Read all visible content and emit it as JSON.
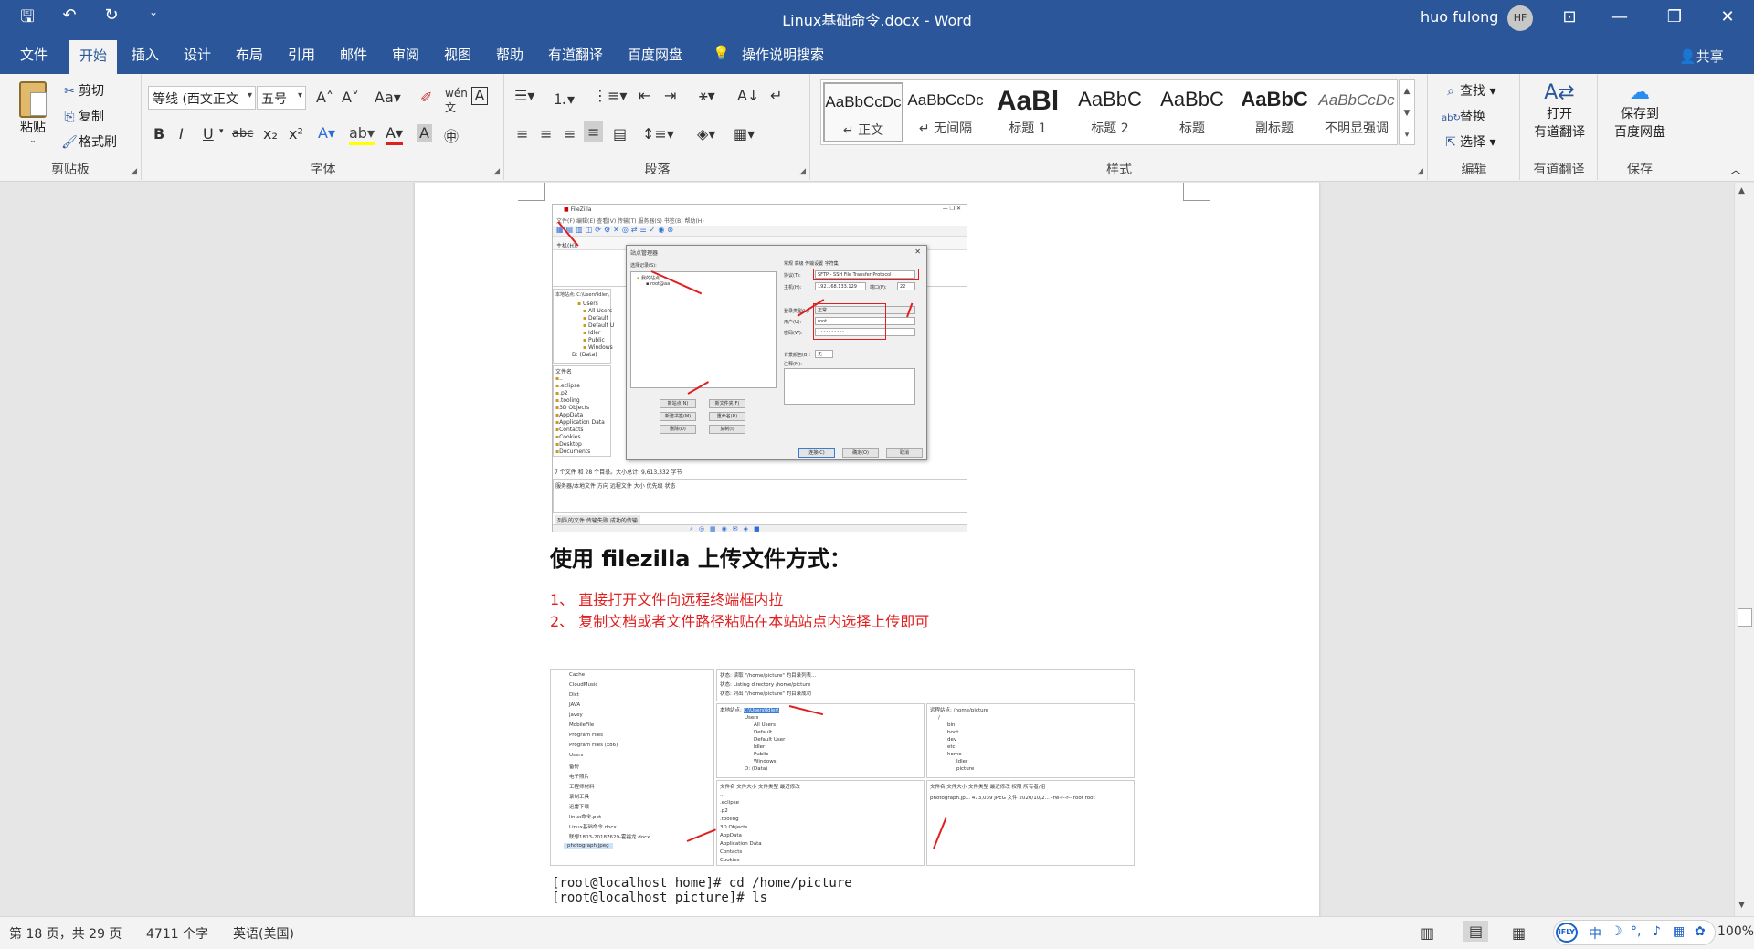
{
  "titlebar": {
    "doc_title": "Linux基础命令.docx  -  Word",
    "user": "huo fulong",
    "avatar": "HF",
    "qat_icons": [
      "save-icon",
      "undo-icon",
      "redo-icon",
      "customize-icon"
    ],
    "window_icons": [
      "ribbon-display-icon",
      "minimize-icon",
      "restore-icon",
      "close-icon"
    ]
  },
  "tabs": [
    "文件",
    "开始",
    "插入",
    "设计",
    "布局",
    "引用",
    "邮件",
    "审阅",
    "视图",
    "帮助",
    "有道翻译",
    "百度网盘"
  ],
  "active_tab": "开始",
  "tell_me": "操作说明搜索",
  "share": "共享",
  "ribbon": {
    "clipboard": {
      "paste": "粘贴",
      "cut": "剪切",
      "copy": "复制",
      "format_painter": "格式刷",
      "label": "剪贴板"
    },
    "font": {
      "name": "等线 (西文正文",
      "size": "五号",
      "label": "字体"
    },
    "paragraph": {
      "label": "段落"
    },
    "styles": {
      "label": "样式",
      "items": [
        {
          "sample": "AaBbCcDc",
          "name": "↵ 正文"
        },
        {
          "sample": "AaBbCcDc",
          "name": "↵ 无间隔"
        },
        {
          "sample": "AaBl",
          "name": "标题 1"
        },
        {
          "sample": "AaBbC",
          "name": "标题 2"
        },
        {
          "sample": "AaBbC",
          "name": "标题"
        },
        {
          "sample": "AaBbC",
          "name": "副标题"
        },
        {
          "sample": "AaBbCcDc",
          "name": "不明显强调"
        }
      ]
    },
    "editing": {
      "find": "查找",
      "replace": "替换",
      "select": "选择",
      "label": "编辑"
    },
    "youdao": {
      "line1": "打开",
      "line2": "有道翻译",
      "label": "有道翻译"
    },
    "baidu": {
      "line1": "保存到",
      "line2": "百度网盘",
      "label": "保存"
    }
  },
  "document": {
    "heading": "使用 filezilla 上传文件方式：",
    "items": [
      "1、 直接打开文件向远程终端框内拉",
      "2、 复制文档或者文件路径粘贴在本站站点内选择上传即可"
    ],
    "terminal_line1": "[root@localhost home]# cd /home/picture",
    "terminal_line2": "[root@localhost picture]# ls"
  },
  "shot1": {
    "title": "FileZilla",
    "menu": "文件(F)   编辑(E)   查看(V)   传输(T)   服务器(S)   书签(B)   帮助(H)",
    "quick": "主机(H):",
    "local_site": "本地站点:   C:\\Users\\Idler\\",
    "tree": [
      "Users",
      "All Users",
      "Default",
      "Default U",
      "Idler",
      "Public",
      "Windows",
      "D: (Data)"
    ],
    "files": [
      "..",
      ".eclipse",
      ".p2",
      ".tooling",
      "3D Objects",
      "AppData",
      "Application Data",
      "Contacts",
      "Cookies",
      "Desktop",
      "Documents"
    ],
    "file_header": "文件名",
    "status_line": "7 个文件 和 28 个目录。大小总计: 9,613,332 字节",
    "queue_header": "服务器/本地文件      方向     远程文件                              大小   优先级    状态",
    "queue_tabs": "列队的文件    传输失败    成功的传输",
    "dialog": {
      "title": "站点管理器",
      "select_entry": "选择记录(S):",
      "my_sites": "我的站点",
      "site_name": "root@aa",
      "tabs": "常规     高级     传输设置     字符集",
      "protocol_label": "协议(T):",
      "protocol": "SFTP - SSH File Transfer Protocol",
      "host_label": "主机(H):",
      "host": "192.168.133.129",
      "port_label": "端口(P):",
      "port": "22",
      "logon_label": "登录类型(L):",
      "logon": "正常",
      "user_label": "用户(U):",
      "user": "root",
      "pass_label": "密码(W):",
      "pass": "••••••••••",
      "bg_label": "背景颜色(B):",
      "bg": "无",
      "comment_label": "注释(M):",
      "btn_new_site": "新站点(N)",
      "btn_new_folder": "新文件夹(F)",
      "btn_new_bookmark": "新建书签(M)",
      "btn_rename": "重命名(R)",
      "btn_delete": "删除(D)",
      "btn_copy": "复制(I)",
      "btn_connect": "连接(C)",
      "btn_ok": "确定(O)",
      "btn_cancel": "取消"
    }
  },
  "shot2": {
    "left_files": [
      "Cache",
      "CloudMusic",
      "Dict",
      "JAVA",
      "javey",
      "MobileFile",
      "Program Files",
      "Program Files (x86)",
      "Users",
      "备份",
      "电子照片",
      "工程师材料",
      "录制工具",
      "迅雷下载",
      "linux命令.ppt",
      "Linux基础命令.docx",
      "联想1803-20187629-霍福龙.docx",
      "photograph.jpeg"
    ],
    "log": [
      "状态: 读取 \"/home/picture\" 的目录列表...",
      "状态: Listing directory /home/picture",
      "状态: 列出 \"/home/picture\" 的目录成功"
    ],
    "local_label": "本地站点:",
    "local_path": "C:\\Users\\Idler\\",
    "remote_label": "远程站点:",
    "remote_path": "/home/picture",
    "local_tree": [
      "Users",
      "All Users",
      "Default",
      "Default User",
      "Idler",
      "Public",
      "Windows",
      "D: (Data)"
    ],
    "remote_tree": [
      "/",
      "bin",
      "boot",
      "dev",
      "etc",
      "home",
      "Idler",
      "picture"
    ],
    "local_files": [
      "..",
      ".eclipse",
      ".p2",
      ".tooling",
      "3D Objects",
      "AppData",
      "Application Data",
      "Contacts",
      "Cookies"
    ],
    "remote_file": "photograph.jp...   473,039   JPEG 文件   2020/10/2...   -rw-r--r--   root root",
    "local_header": "文件名          文件大小  文件类型       最近修改",
    "remote_header": "文件名          文件大小  文件类型    最近修改     权限       所有者/组"
  },
  "statusbar": {
    "page": "第 18 页，共 29 页",
    "words": "4711 个字",
    "lang": "英语(美国)",
    "zoom": "100%",
    "ime_brand": "iFLY",
    "ime_items": [
      "中",
      "☽",
      "°,",
      "♪",
      "▦",
      "✿"
    ]
  }
}
